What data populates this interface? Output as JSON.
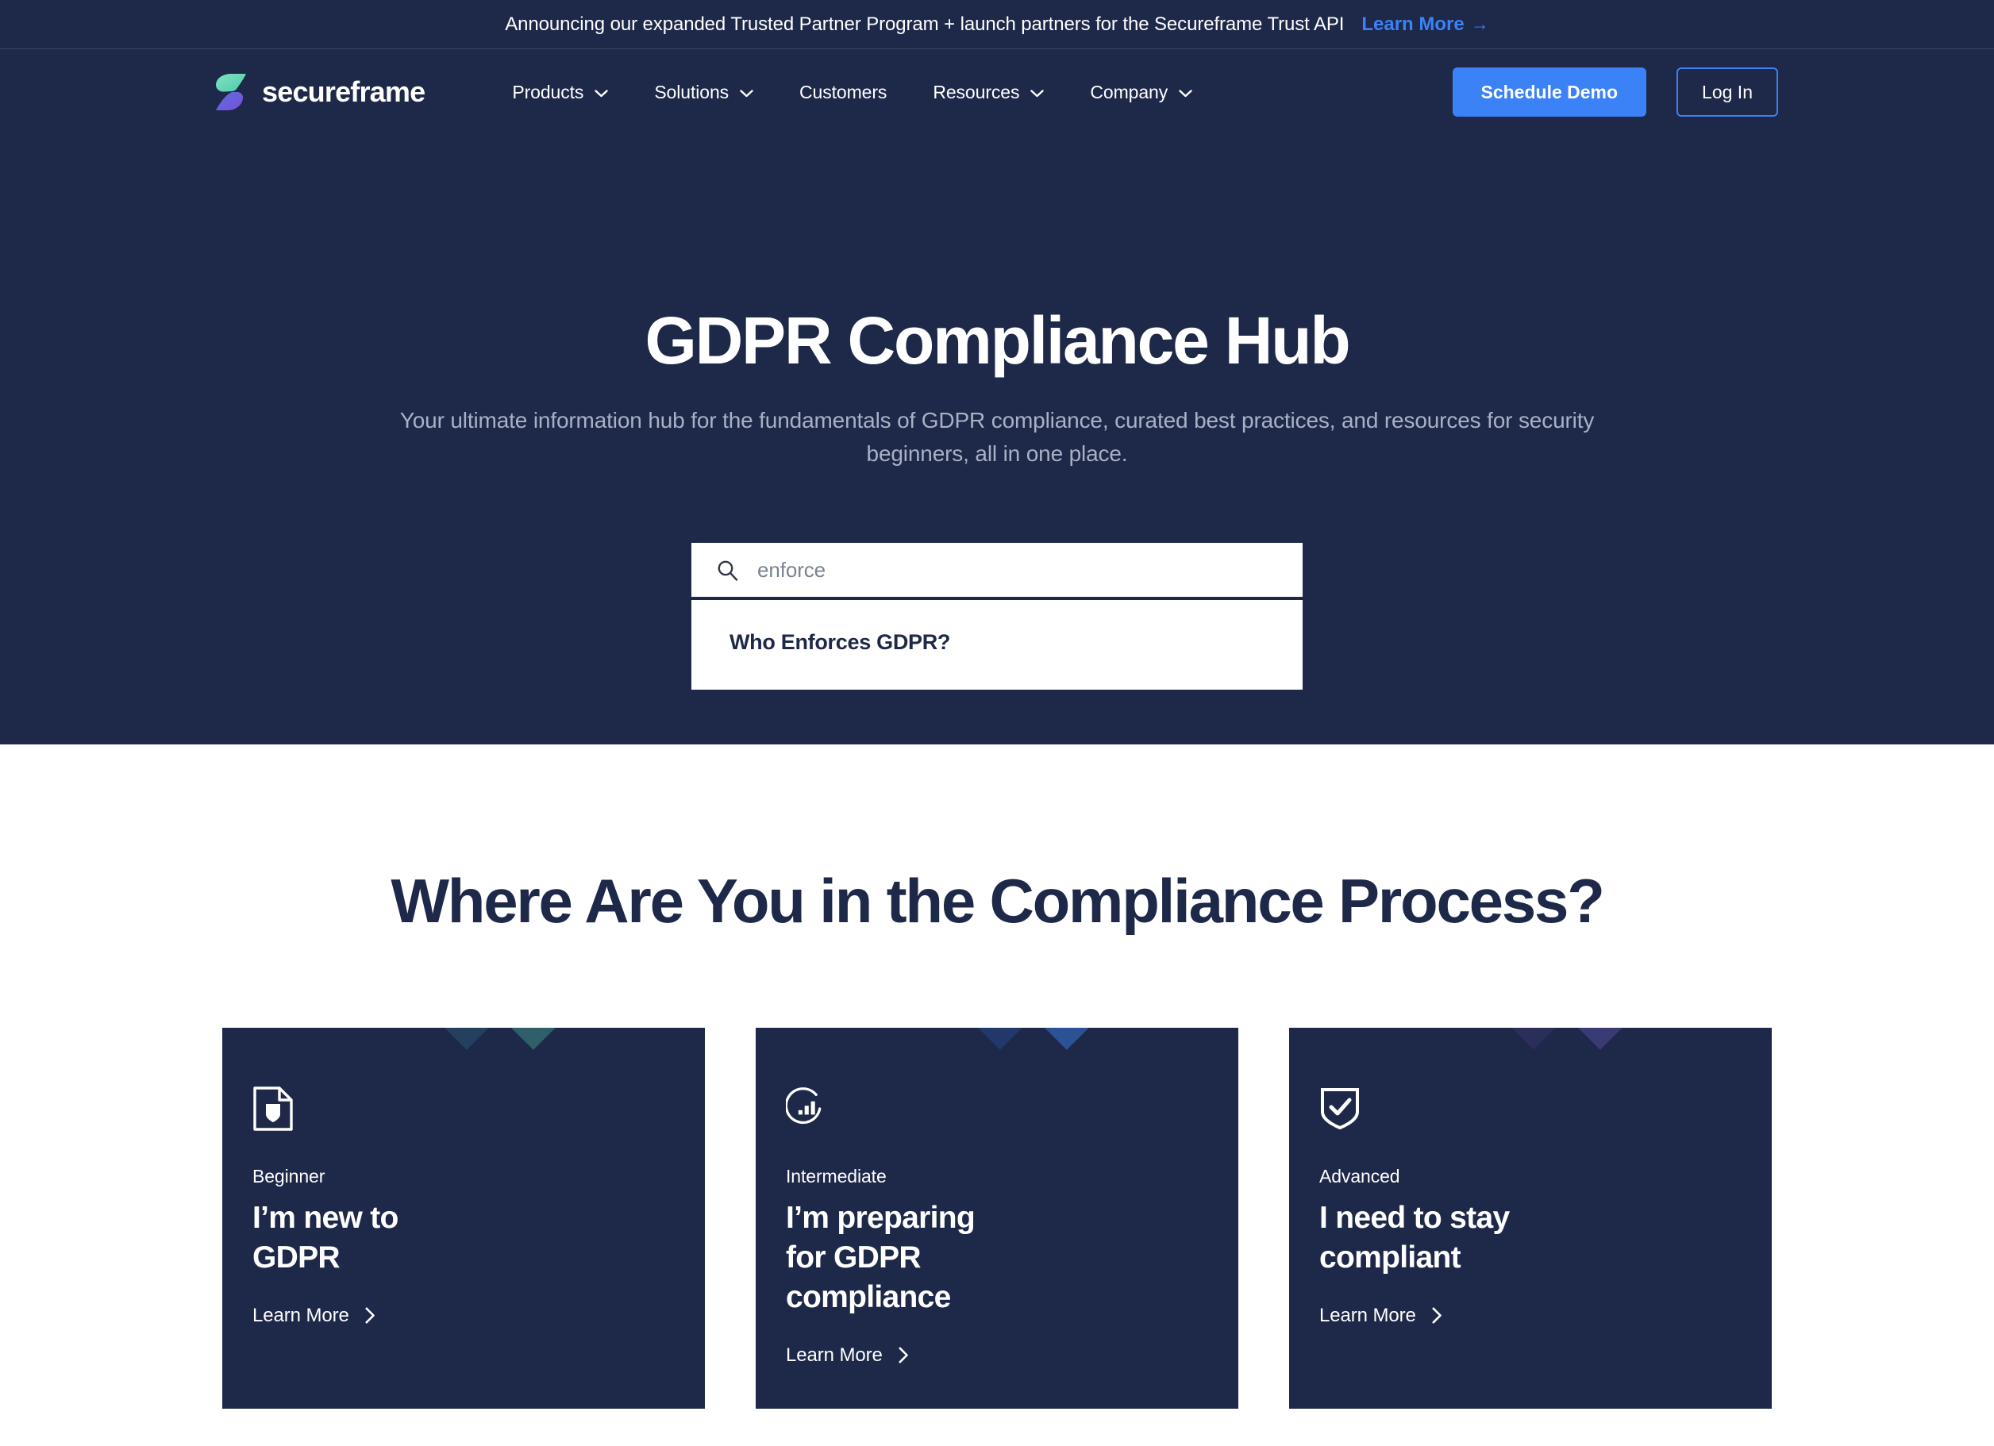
{
  "announcement": {
    "text": "Announcing our expanded Trusted Partner Program + launch partners for the Secureframe Trust API",
    "link_label": "Learn More",
    "link_arrow": "→",
    "background": "#1e2848",
    "link_color": "#3b82f6"
  },
  "nav": {
    "brand": "secureframe",
    "items": [
      {
        "label": "Products",
        "has_chevron": true
      },
      {
        "label": "Solutions",
        "has_chevron": true
      },
      {
        "label": "Customers",
        "has_chevron": false
      },
      {
        "label": "Resources",
        "has_chevron": true
      },
      {
        "label": "Company",
        "has_chevron": true
      }
    ],
    "demo_button": "Schedule Demo",
    "login_button": "Log In",
    "accent_color": "#3b82f6"
  },
  "hero": {
    "title": "GDPR Compliance Hub",
    "subtitle": "Your ultimate information hub for the fundamentals of GDPR compliance, curated best practices, and resources for security beginners, all in one place.",
    "background": "#1e2848"
  },
  "search": {
    "icon": "search-icon",
    "value": "enforce",
    "placeholder": "enforce",
    "results": [
      {
        "label": "Who Enforces GDPR?"
      }
    ]
  },
  "compliance_section": {
    "title": "Where Are You in the Compliance Process?",
    "cards": [
      {
        "icon": "document-shield-icon",
        "level": "Beginner",
        "title": "I’m new to\nGDPR",
        "cta": "Learn More",
        "stripe_colors": [
          "#2f6069",
          "#24405f",
          "#1e2848"
        ]
      },
      {
        "icon": "circle-bar-chart-icon",
        "level": "Intermediate",
        "title": "I’m preparing\nfor GDPR\ncompliance",
        "cta": "Learn More",
        "stripe_colors": [
          "#2b5295",
          "#22386a",
          "#1e2848"
        ]
      },
      {
        "icon": "shield-check-icon",
        "level": "Advanced",
        "title": "I need to stay\ncompliant",
        "cta": "Learn More",
        "stripe_colors": [
          "#3a3a74",
          "#2a2e58",
          "#1e2848"
        ]
      }
    ]
  }
}
